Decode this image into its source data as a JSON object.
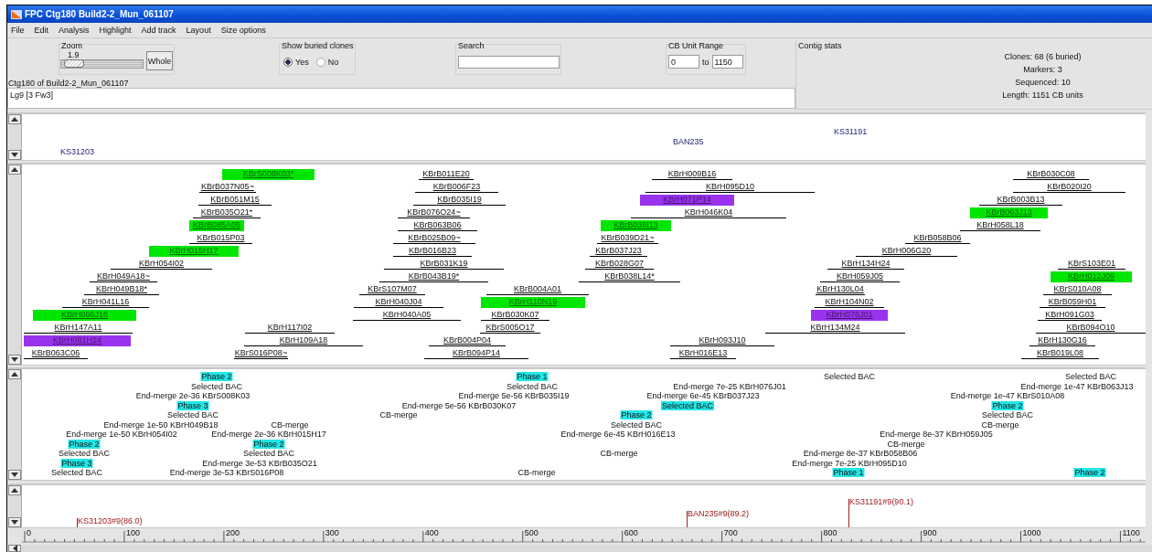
{
  "window": {
    "title": "FPC Ctg180 Build2-2_Mun_061107"
  },
  "menu": [
    "File",
    "Edit",
    "Analysis",
    "Highlight",
    "Add track",
    "Layout",
    "Size options"
  ],
  "zoom": {
    "label": "Zoom",
    "value": "1.9",
    "level": 0.05,
    "button": "Whole"
  },
  "buried": {
    "label": "Show buried clones",
    "options": [
      {
        "label": "Yes",
        "selected": true
      },
      {
        "label": "No",
        "selected": false
      }
    ]
  },
  "search": {
    "label": "Search"
  },
  "range": {
    "label": "CB Unit Range",
    "from": "0",
    "to_label": "to",
    "to": "1150"
  },
  "contig_name": "Ctg180 of Build2-2_Mun_061107",
  "notes": "Lg9 [3 Fw3]",
  "stats": {
    "label": "Contig stats",
    "lines": [
      "Clones: 68 (6 buried)",
      "Markers: 3",
      "Sequenced: 10",
      "Length: 1151 CB units"
    ]
  },
  "markers": [
    {
      "name": "KS31203"
    },
    {
      "name": "BAN235"
    },
    {
      "name": "KS31191"
    }
  ],
  "clones": [
    {
      "name": "KBrS008K03*",
      "color": "#00e600"
    },
    {
      "name": "KBrB011E20"
    },
    {
      "name": "KBrH009B16"
    },
    {
      "name": "KBrB030C08"
    },
    {
      "name": "KBrB037N05~"
    },
    {
      "name": "KBrB006F23"
    },
    {
      "name": "KBrH095D10"
    },
    {
      "name": "KBrB020I20"
    },
    {
      "name": "KBrB051M15"
    },
    {
      "name": "KBrB035I19"
    },
    {
      "name": "KBrH071P14",
      "color": "#9933ee"
    },
    {
      "name": "KBrB003B13"
    },
    {
      "name": "KBrB035O21*"
    },
    {
      "name": "KBrB076O24~"
    },
    {
      "name": "KBrH046K04"
    },
    {
      "name": "KBrB063J13",
      "color": "#00e600"
    },
    {
      "name": "KBrB085A05",
      "color": "#00e600"
    },
    {
      "name": "KBrB063B06"
    },
    {
      "name": "KBrB036I13",
      "color": "#00e600"
    },
    {
      "name": "KBrH058L18"
    },
    {
      "name": "KBrB015P03"
    },
    {
      "name": "KBrB025B09~"
    },
    {
      "name": "KBrB039D21~"
    },
    {
      "name": "KBrB058B06"
    },
    {
      "name": "KBrH015H17",
      "color": "#00e600"
    },
    {
      "name": "KBrB016B23"
    },
    {
      "name": "KBrB037J23"
    },
    {
      "name": "KBrH006G20"
    },
    {
      "name": "KBrH054I02"
    },
    {
      "name": "KBrB031K19"
    },
    {
      "name": "KBrB028G07"
    },
    {
      "name": "KBrH134H24"
    },
    {
      "name": "KBrS103E01"
    },
    {
      "name": "KBrH049A18~"
    },
    {
      "name": "KBrB043B19*"
    },
    {
      "name": "KBrB038L14*"
    },
    {
      "name": "KBrH059J05"
    },
    {
      "name": "KBrH012J09",
      "color": "#00e600"
    },
    {
      "name": "KBrH049B18*"
    },
    {
      "name": "KBrS107M07"
    },
    {
      "name": "KBrB004A01"
    },
    {
      "name": "KBrH130L04"
    },
    {
      "name": "KBrS010A08"
    },
    {
      "name": "KBrH041L16"
    },
    {
      "name": "KBrH040J04"
    },
    {
      "name": "KBrH110N19",
      "color": "#00e600"
    },
    {
      "name": "KBrH104N02"
    },
    {
      "name": "KBrB059H01"
    },
    {
      "name": "KBrH066J16",
      "color": "#00e600"
    },
    {
      "name": "KBrH040A05"
    },
    {
      "name": "KBrB030K07"
    },
    {
      "name": "KBrH076J01",
      "color": "#9933ee"
    },
    {
      "name": "KBrH091G03"
    },
    {
      "name": "KBrH147A11"
    },
    {
      "name": "KBrH117I02"
    },
    {
      "name": "KBrS005O17"
    },
    {
      "name": "KBrH134M24"
    },
    {
      "name": "KBrB094O10"
    },
    {
      "name": "KBrH081H24",
      "color": "#9933ee"
    },
    {
      "name": "KBrH109A18"
    },
    {
      "name": "KBrB004P04"
    },
    {
      "name": "KBrH093J10"
    },
    {
      "name": "KBrH130G16"
    },
    {
      "name": "KBrB063C06"
    },
    {
      "name": "KBrS016P08~"
    },
    {
      "name": "KBrB094P14"
    },
    {
      "name": "KBrH016E13"
    },
    {
      "name": "KBrB019L08"
    }
  ],
  "remarks": [
    {
      "text": "Phase 2",
      "highlighted": true
    },
    {
      "text": "Phase 1",
      "highlighted": true
    },
    {
      "text": "Selected BAC",
      "highlighted": false
    },
    {
      "text": "Selected BAC",
      "highlighted": false
    },
    {
      "text": "Selected BAC",
      "highlighted": false
    },
    {
      "text": "Selected BAC",
      "highlighted": false
    },
    {
      "text": "End-merge 7e-25 KBrH076J01",
      "highlighted": false
    },
    {
      "text": "End-merge 1e-47 KBrB063J13",
      "highlighted": false
    },
    {
      "text": "End-merge 2e-36 KBrS008K03",
      "highlighted": false
    },
    {
      "text": "End-merge 5e-56 KBrB035I19",
      "highlighted": false
    },
    {
      "text": "End-merge 6e-45 KBrB037J23",
      "highlighted": false
    },
    {
      "text": "End-merge 1e-47 KBrS010A08",
      "highlighted": false
    },
    {
      "text": "Phase 3",
      "highlighted": true
    },
    {
      "text": "End-merge 5e-56 KBrB030K07",
      "highlighted": false
    },
    {
      "text": "Selected BAC",
      "highlighted": true
    },
    {
      "text": "Phase 2",
      "highlighted": true
    },
    {
      "text": "Selected BAC",
      "highlighted": false
    },
    {
      "text": "CB-merge",
      "highlighted": false
    },
    {
      "text": "Phase 2",
      "highlighted": true
    },
    {
      "text": "Selected BAC",
      "highlighted": false
    },
    {
      "text": "End-merge 1e-50 KBrH049B18",
      "highlighted": false
    },
    {
      "text": "CB-merge",
      "highlighted": false
    },
    {
      "text": "Selected BAC",
      "highlighted": false
    },
    {
      "text": "CB-merge",
      "highlighted": false
    },
    {
      "text": "End-merge 1e-50 KBrH054I02",
      "highlighted": false
    },
    {
      "text": "End-merge 2e-36 KBrH015H17",
      "highlighted": false
    },
    {
      "text": "End-merge 6e-45 KBrH016E13",
      "highlighted": false
    },
    {
      "text": "End-merge 8e-37 KBrH059J05",
      "highlighted": false
    },
    {
      "text": "Phase 2",
      "highlighted": true
    },
    {
      "text": "Phase 2",
      "highlighted": true
    },
    {
      "text": "CB-merge",
      "highlighted": false
    },
    {
      "text": "Selected BAC",
      "highlighted": false
    },
    {
      "text": "Selected BAC",
      "highlighted": false
    },
    {
      "text": "CB-merge",
      "highlighted": false
    },
    {
      "text": "End-merge 8e-37 KBrB058B06",
      "highlighted": false
    },
    {
      "text": "Phase 3",
      "highlighted": true
    },
    {
      "text": "End-merge 3e-53 KBrB035O21",
      "highlighted": false
    },
    {
      "text": "End-merge 7e-25 KBrH095D10",
      "highlighted": false
    },
    {
      "text": "Selected BAC",
      "highlighted": false
    },
    {
      "text": "End-merge 3e-53 KBrS016P08",
      "highlighted": false
    },
    {
      "text": "CB-merge",
      "highlighted": false
    },
    {
      "text": "Phase 1",
      "highlighted": true
    },
    {
      "text": "Phase 2",
      "highlighted": true
    }
  ],
  "anchors": [
    {
      "label": "KS31203#9(86.0)"
    },
    {
      "label": "BAN235#9(89.2)"
    },
    {
      "label": "KS31191#9(90.1)"
    }
  ],
  "ruler": {
    "labels": [
      "0",
      "100",
      "200",
      "300",
      "400",
      "500",
      "600",
      "700",
      "800",
      "900",
      "1000",
      "1100"
    ]
  }
}
